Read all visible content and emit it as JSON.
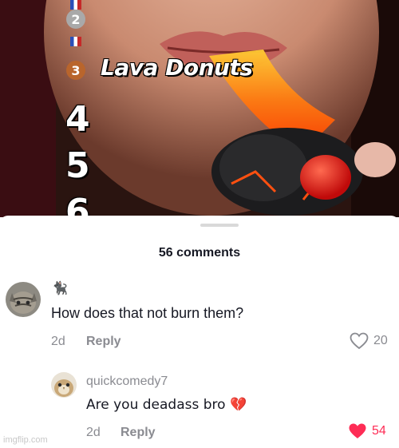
{
  "video": {
    "title": "Lava Donuts",
    "ranks": [
      "2",
      "3",
      "4",
      "5",
      "6"
    ]
  },
  "comments_header": {
    "count_label": "56 comments"
  },
  "comments": [
    {
      "username": "🐈‍⬛",
      "text": "How does that not burn them?",
      "age": "2d",
      "reply_label": "Reply",
      "likes": "20",
      "liked": false
    },
    {
      "username": "quickcomedy7",
      "text": "Are you deadass bro 💔",
      "age": "2d",
      "reply_label": "Reply",
      "likes": "54",
      "liked": true
    }
  ],
  "watermark": "imgflip.com",
  "colors": {
    "like_active": "#fe2c55",
    "secondary_text": "#8a8b91",
    "primary_text": "#161823"
  }
}
